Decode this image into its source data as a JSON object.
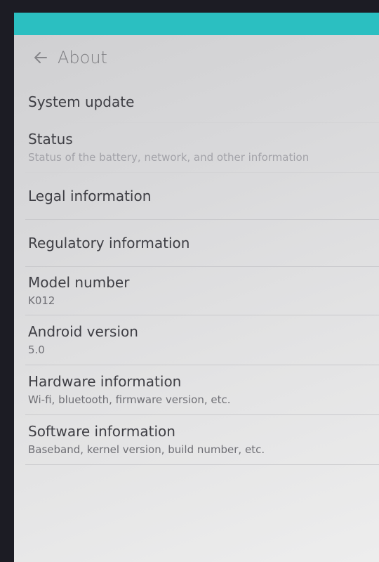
{
  "header": {
    "title": "About"
  },
  "items": [
    {
      "title": "System update",
      "summary": ""
    },
    {
      "title": "Status",
      "summary": "Status of the battery, network, and other information"
    },
    {
      "title": "Legal information",
      "summary": ""
    },
    {
      "title": "Regulatory information",
      "summary": ""
    },
    {
      "title": "Model number",
      "summary": "K012"
    },
    {
      "title": "Android version",
      "summary": "5.0"
    },
    {
      "title": "Hardware information",
      "summary": "Wi-fi, bluetooth, firmware version, etc."
    },
    {
      "title": "Software information",
      "summary": "Baseband, kernel version, build number, etc."
    }
  ],
  "colors": {
    "status_bar": "#2bbfc1",
    "title_text": "#3e3e44",
    "summary_text": "#6e6e74"
  },
  "icons": {
    "back": "arrow-left"
  }
}
